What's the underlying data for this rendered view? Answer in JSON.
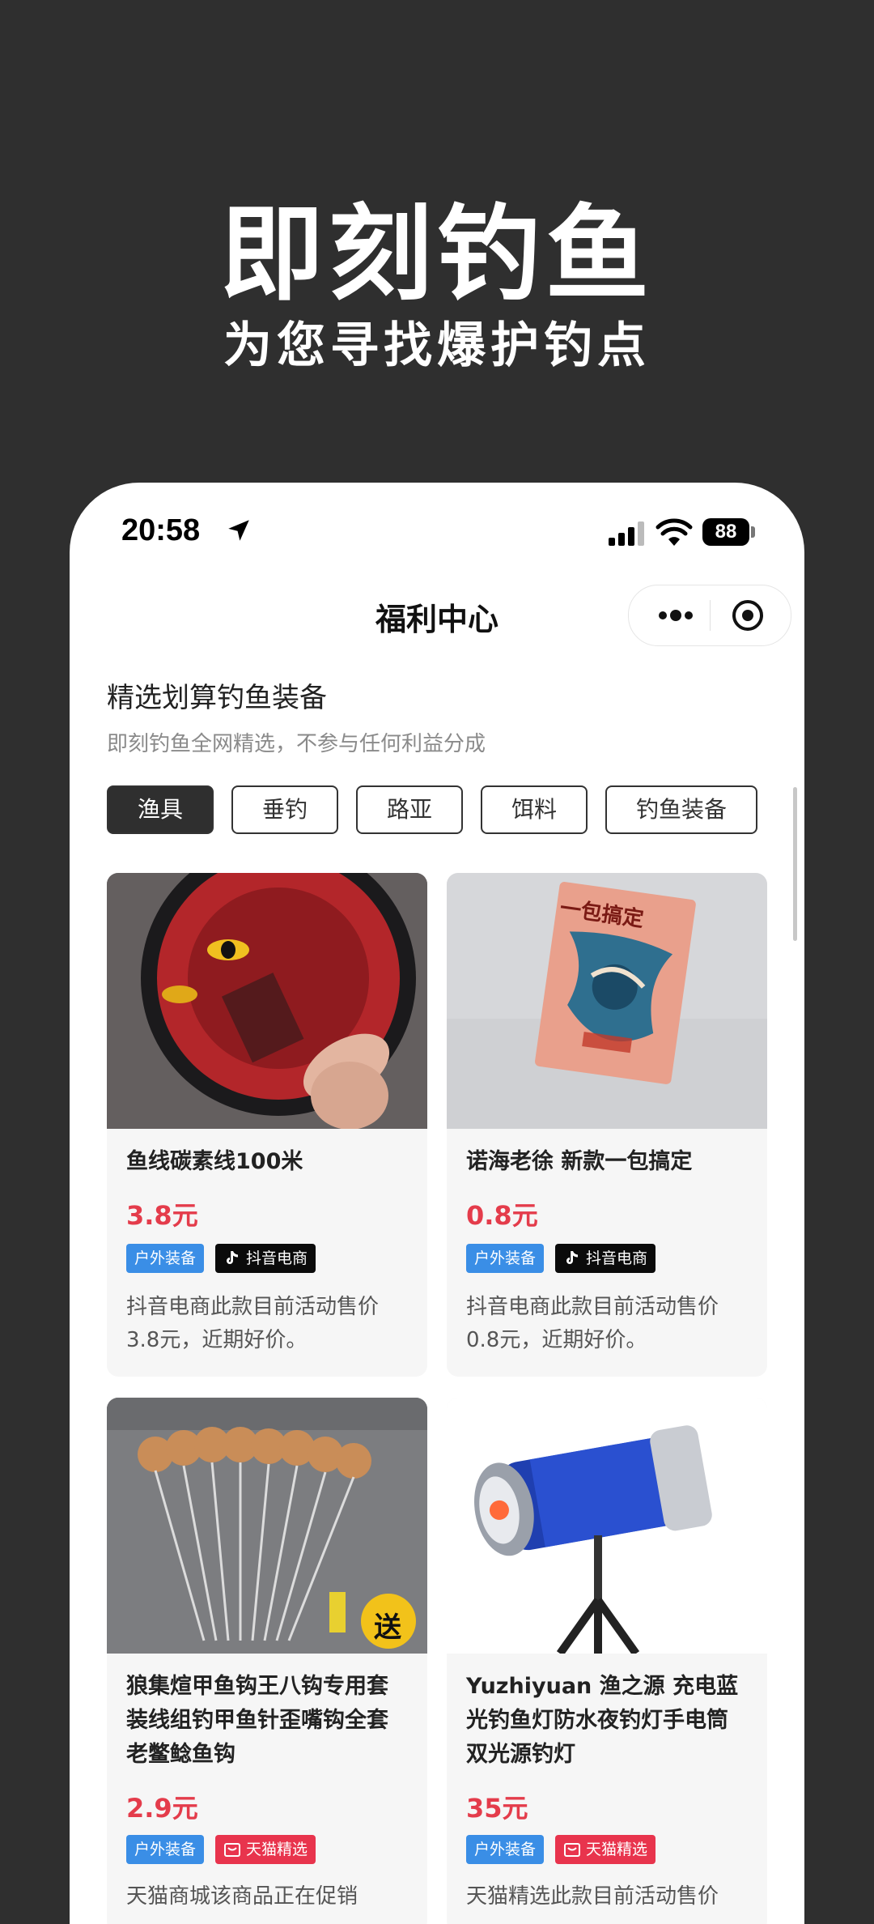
{
  "promo": {
    "title": "即刻钓鱼",
    "subtitle": "为您寻找爆护钓点"
  },
  "status_bar": {
    "time": "20:58",
    "battery": "88"
  },
  "nav": {
    "title": "福利中心"
  },
  "section": {
    "title": "精选划算钓鱼装备",
    "subtitle": "即刻钓鱼全网精选，不参与任何利益分成"
  },
  "tabs": [
    {
      "label": "渔具",
      "active": true
    },
    {
      "label": "垂钓",
      "active": false
    },
    {
      "label": "路亚",
      "active": false
    },
    {
      "label": "饵料",
      "active": false
    },
    {
      "label": "钓鱼装备",
      "active": false
    }
  ],
  "products": [
    {
      "name": "鱼线碳素线100米",
      "price": "3.8元",
      "category": "户外装备",
      "source": "抖音电商",
      "desc": "抖音电商此款目前活动售价3.8元，近期好价。"
    },
    {
      "name": "诺海老徐 新款一包搞定",
      "price": "0.8元",
      "category": "户外装备",
      "source": "抖音电商",
      "desc": "抖音电商此款目前活动售价0.8元，近期好价。",
      "image_text": "一包搞定"
    },
    {
      "name": "狼集煊甲鱼钩王八钩专用套装线组钓甲鱼针歪嘴钩全套老鳖鲶鱼钩",
      "price": "2.9元",
      "category": "户外装备",
      "source": "天猫精选",
      "desc": "天猫商城该商品正在促销",
      "image_text": "送"
    },
    {
      "name": "Yuzhiyuan 渔之源 充电蓝光钓鱼灯防水夜钓灯手电筒双光源钓灯",
      "price": "35元",
      "category": "户外装备",
      "source": "天猫精选",
      "desc": "天猫精选此款目前活动售价"
    }
  ],
  "colors": {
    "background": "#2f2f2f",
    "price": "#e43c4b",
    "category_badge": "#3a8ee6",
    "douyin_badge": "#0b0b0b",
    "tmall_badge": "#e8344d"
  }
}
